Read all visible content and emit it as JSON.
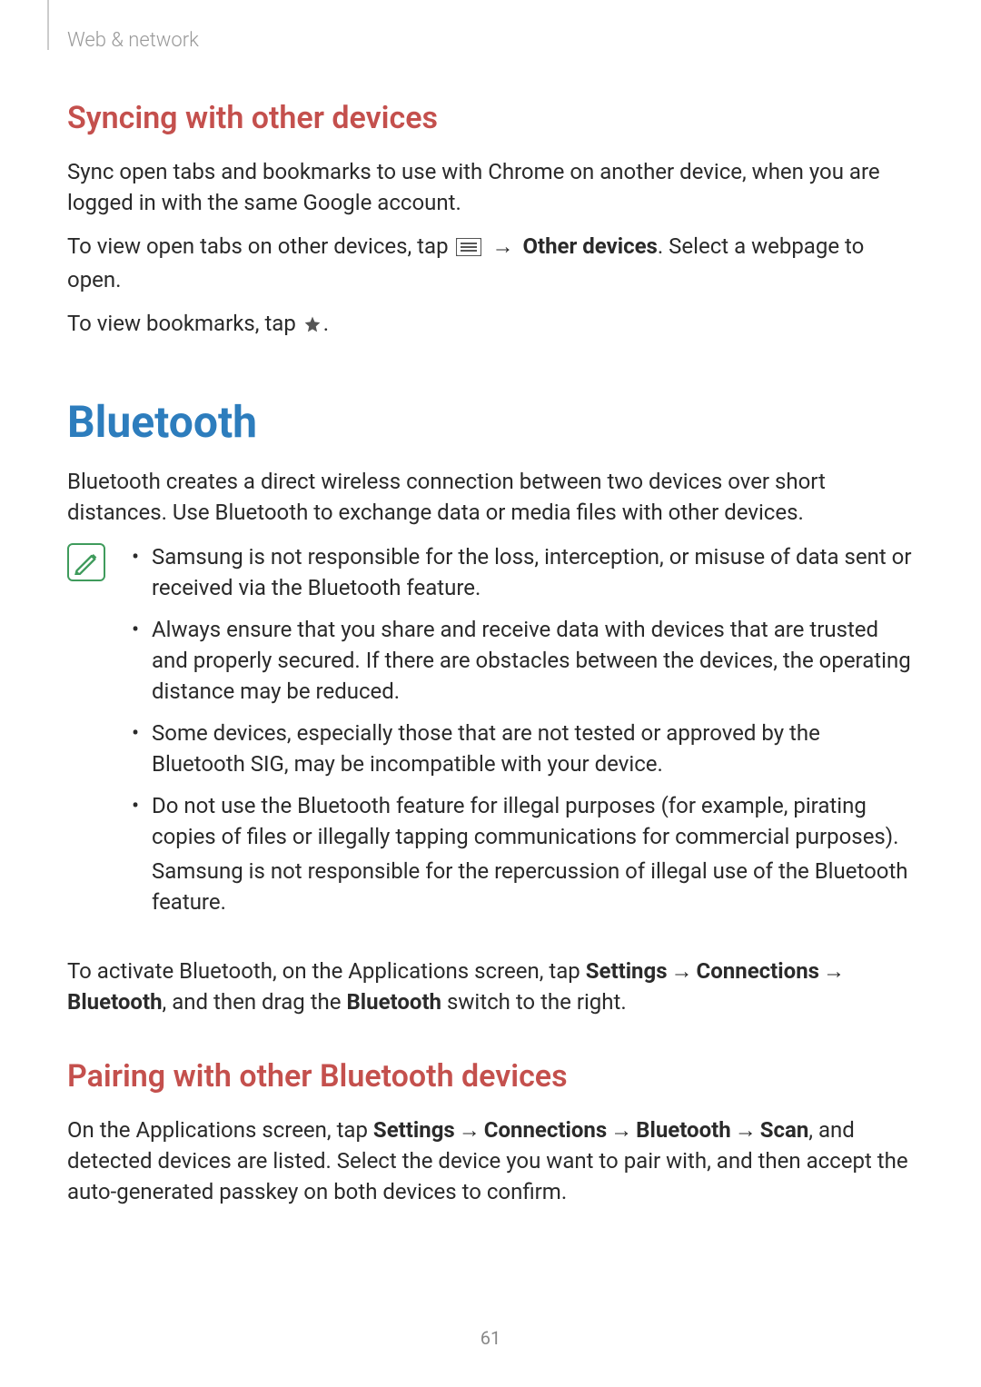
{
  "breadcrumb": "Web & network",
  "section1": {
    "heading": "Syncing with other devices",
    "p1": "Sync open tabs and bookmarks to use with Chrome on another device, when you are logged in with the same Google account.",
    "p2_pre": "To view open tabs on other devices, tap ",
    "p2_arrow": " → ",
    "p2_bold": "Other devices",
    "p2_post": ". Select a webpage to open.",
    "p3_pre": "To view bookmarks, tap ",
    "p3_post": "."
  },
  "section2": {
    "heading": "Bluetooth",
    "intro": "Bluetooth creates a direct wireless connection between two devices over short distances. Use Bluetooth to exchange data or media files with other devices.",
    "notes": [
      "Samsung is not responsible for the loss, interception, or misuse of data sent or received via the Bluetooth feature.",
      "Always ensure that you share and receive data with devices that are trusted and properly secured. If there are obstacles between the devices, the operating distance may be reduced.",
      "Some devices, especially those that are not tested or approved by the Bluetooth SIG, may be incompatible with your device."
    ],
    "note4_a": "Do not use the Bluetooth feature for illegal purposes (for example, pirating copies of files or illegally tapping communications for commercial purposes).",
    "note4_b": "Samsung is not responsible for the repercussion of illegal use of the Bluetooth feature.",
    "activate": {
      "pre": "To activate Bluetooth, on the Applications screen, tap ",
      "b1": "Settings",
      "arrow": " → ",
      "b2": "Connections",
      "b3": "Bluetooth",
      "mid": ", and then drag the ",
      "b4": "Bluetooth",
      "post": " switch to the right."
    }
  },
  "section3": {
    "heading": "Pairing with other Bluetooth devices",
    "p": {
      "pre": "On the Applications screen, tap ",
      "b1": "Settings",
      "arrow": " → ",
      "b2": "Connections",
      "b3": "Bluetooth",
      "b4": "Scan",
      "post": ", and detected devices are listed. Select the device you want to pair with, and then accept the auto-generated passkey on both devices to confirm."
    }
  },
  "pageNumber": "61"
}
